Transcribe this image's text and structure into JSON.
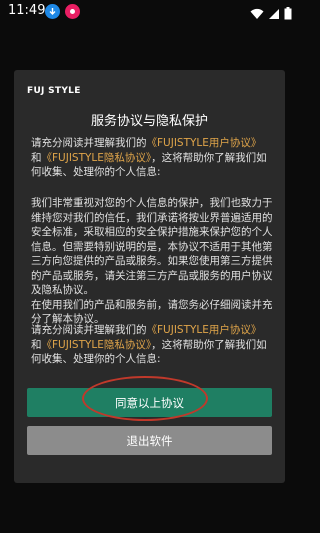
{
  "status_bar": {
    "time": "11:49",
    "notification_icons": [
      "download-arrow-icon",
      "bubble-app-icon"
    ],
    "system_icons": [
      "wifi-icon",
      "cellular-signal-icon",
      "battery-icon"
    ]
  },
  "dialog": {
    "brand": "FUJ STYLE",
    "title": "服务协议与隐私保护",
    "para1": {
      "prefix": "请充分阅读并理解我们的",
      "link1": "《FUJISTYLE用户协议》",
      "and": "和",
      "link2": "《FUJISTYLE隐私协议》",
      "suffix": "，这将帮助你了解我们如何收集、处理你的个人信息:"
    },
    "para2": {
      "text": "我们非常重视对您的个人信息的保护，我们也致力于维持您对我们的信任，我们承诺将按业界普遍适用的安全标准，采取相应的安全保护措施来保护您的个人信息。但需要特别说明的是，本协议不适用于其他第三方向您提供的产品或服务。如果您使用第三方提供的产品或服务，请关注第三方产品或服务的用户协议及隐私协议。",
      "text2": "在使用我们的产品和服务前，请您务必仔细阅读并充分了解本协议。"
    },
    "para3": {
      "prefix": "请充分阅读并理解我们的",
      "link1": "《FUJISTYLE用户协议》",
      "and": "和",
      "link2": "《FUJISTYLE隐私协议》",
      "suffix": "，这将帮助你了解我们如何收集、处理你的个人信息:"
    },
    "agree_label": "同意以上协议",
    "exit_label": "退出软件"
  },
  "colors": {
    "agree_button": "#1f7f63",
    "exit_button": "#8c8c8c",
    "link": "#e0a54a",
    "annotation": "#c0392b"
  }
}
